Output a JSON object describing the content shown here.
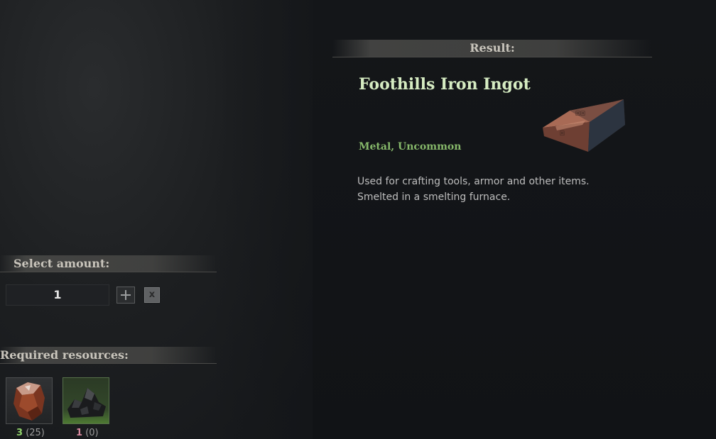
{
  "result": {
    "header": "Result:",
    "title": "Foothills Iron Ingot",
    "tags": "Metal, Uncommon",
    "description": [
      "Used for crafting tools, armor and other items.",
      "Smelted in a smelting furnace."
    ],
    "icon": "iron-ingot-icon"
  },
  "amount": {
    "header": "Select amount:",
    "value": "1",
    "clear_label": "x"
  },
  "requirements": {
    "header": "Required resources:",
    "items": [
      {
        "icon": "iron-ore-icon",
        "needed": "3",
        "owned": "(25)",
        "status_color": "#8fd06a"
      },
      {
        "icon": "coal-icon",
        "needed": "1",
        "owned": "(0)",
        "status_color": "#d98aa0"
      }
    ]
  },
  "colors": {
    "title": "#d6ecc2",
    "tags": "#86b86a",
    "background": "#16181b"
  }
}
